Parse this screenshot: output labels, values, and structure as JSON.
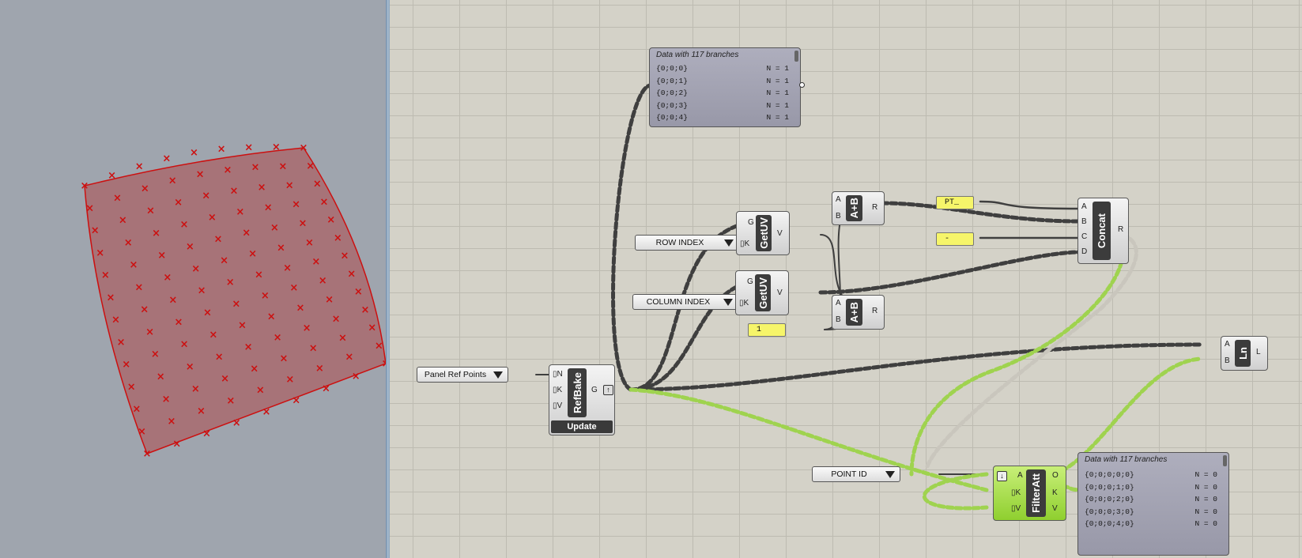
{
  "viewport": {
    "surface_color": "#a86a6e",
    "edge_color": "#cc1010",
    "marker_color": "#cc1010",
    "marker_glyph": "×"
  },
  "canvas": {
    "panel_top": {
      "title": "Data with 117 branches",
      "rows": [
        {
          "path": "{0;0;0}",
          "count": "N = 1"
        },
        {
          "path": "{0;0;1}",
          "count": "N = 1"
        },
        {
          "path": "{0;0;2}",
          "count": "N = 1"
        },
        {
          "path": "{0;0;3}",
          "count": "N = 1"
        },
        {
          "path": "{0;0;4}",
          "count": "N = 1"
        }
      ]
    },
    "panel_bottom": {
      "title": "Data with 117 branches",
      "rows": [
        {
          "path": "{0;0;0;0;0}",
          "count": "N = 0"
        },
        {
          "path": "{0;0;0;1;0}",
          "count": "N = 0"
        },
        {
          "path": "{0;0;0;2;0}",
          "count": "N = 0"
        },
        {
          "path": "{0;0;0;3;0}",
          "count": "N = 0"
        },
        {
          "path": "{0;0;0;4;0}",
          "count": "N = 0"
        }
      ]
    },
    "value_lists": {
      "row_index": "ROW INDEX",
      "column_index": "COLUMN INDEX",
      "panel_ref_points": "Panel Ref Points",
      "point_id": "POINT ID"
    },
    "yellow_panels": {
      "pt_prefix": "PT_",
      "separator": "-",
      "one": "1"
    },
    "components": {
      "getuv1": {
        "name": "GetUV",
        "in": [
          "G",
          "▯K"
        ],
        "out": [
          "V"
        ]
      },
      "getuv2": {
        "name": "GetUV",
        "in": [
          "G",
          "▯K"
        ],
        "out": [
          "V"
        ]
      },
      "add1": {
        "name": "A+B",
        "in": [
          "A",
          "B"
        ],
        "out": [
          "R"
        ]
      },
      "add2": {
        "name": "A+B",
        "in": [
          "A",
          "B"
        ],
        "out": [
          "R"
        ]
      },
      "concat": {
        "name": "Concat",
        "in": [
          "A",
          "B",
          "C",
          "D"
        ],
        "out": [
          "R"
        ]
      },
      "line": {
        "name": "Ln",
        "in": [
          "A",
          "B"
        ],
        "out": [
          "L"
        ]
      },
      "refbake": {
        "name": "RefBake",
        "in": [
          "▯N",
          "▯K",
          "▯V"
        ],
        "out": [
          "G"
        ],
        "button": "Update"
      },
      "filteratt": {
        "name": "FilterAtt",
        "in": [
          "A",
          "▯K",
          "▯V"
        ],
        "out": [
          "O",
          "K",
          "V"
        ]
      }
    },
    "colors": {
      "wire_dark": "#3f3f3f",
      "wire_green": "#9fd34f",
      "wire_grey_light": "#c9c6bd",
      "component_dark": "#3c3c3c",
      "panel_fill": "#a6a6b5",
      "yellow_panel": "#f6f56a",
      "selected_green": "#a6e04a"
    },
    "icons": [
      "dropdown-arrow-icon",
      "output-param-icon",
      "filter-param-icon"
    ]
  }
}
